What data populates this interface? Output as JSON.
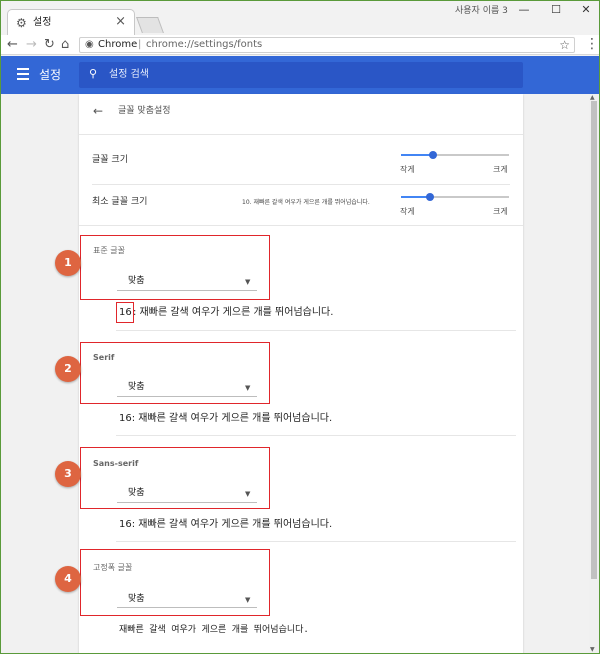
{
  "browser": {
    "tab_title": "설정",
    "tab_icon": "gear-icon",
    "user_name": "사용자 이름 3",
    "omnibox_origin": "Chrome",
    "omnibox_url": "chrome://settings/fonts"
  },
  "header": {
    "title": "설정",
    "search_placeholder": "설정 검색",
    "accent_color": "#3367d6"
  },
  "page": {
    "title": "글꼴 맞춤설정",
    "font_size": {
      "label": "글꼴 크기",
      "min_label": "작게",
      "max_label": "크게",
      "level": 0.3
    },
    "min_font_size": {
      "label": "최소 글꼴 크기",
      "sample": "10. 재빠른 갈색 여우가 게으른 개를 뛰어넘습니다.",
      "min_label": "작게",
      "max_label": "크게",
      "level": 0.27
    },
    "sections": [
      {
        "number": "1",
        "label": "표준 글꼴",
        "value": "맞춤",
        "size_prefix": "16",
        "sample": ": 재빠른 갈색 여우가 게으른 개를 뛰어넘습니다."
      },
      {
        "number": "2",
        "label": "Serif",
        "value": "맞춤",
        "size_prefix": "",
        "sample": "16: 재빠른 갈색 여우가 게으른 개를 뛰어넘습니다."
      },
      {
        "number": "3",
        "label": "Sans-serif",
        "value": "맞춤",
        "size_prefix": "",
        "sample": "16: 재빠른 갈색 여우가 게으른 개를 뛰어넘습니다."
      },
      {
        "number": "4",
        "label": "고정폭 글꼴",
        "value": "맞춤",
        "size_prefix": "",
        "sample": "재빠른 갈색 여우가 게으른 개를 뛰어넘습니다."
      }
    ]
  },
  "annotation_colors": {
    "box": "#e0262b",
    "badge": "#de6541"
  }
}
